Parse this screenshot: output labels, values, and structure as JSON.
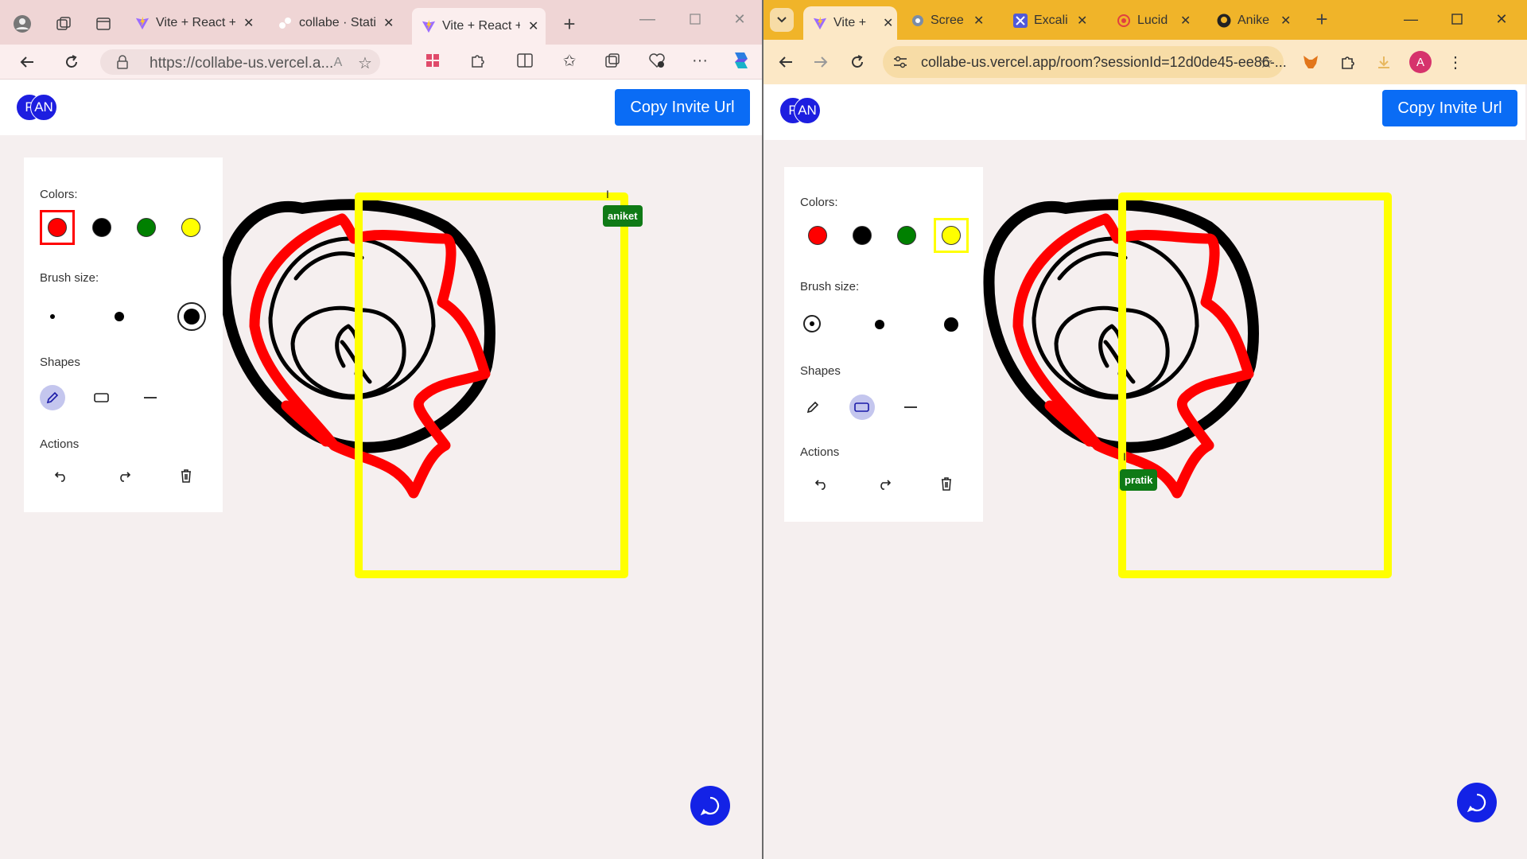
{
  "left_window": {
    "browser": "edge",
    "tabs": [
      {
        "title": "Vite + React +",
        "active": false
      },
      {
        "title": "collabe · Stati",
        "active": false
      },
      {
        "title": "Vite + React +",
        "active": true
      }
    ],
    "address": "https://collabe-us.vercel.a...",
    "app": {
      "avatars": [
        "P",
        "AN"
      ],
      "invite_label": "Copy Invite Url",
      "toolbox": {
        "colors_label": "Colors:",
        "brush_label": "Brush size:",
        "shapes_label": "Shapes",
        "actions_label": "Actions",
        "selected_color": "red",
        "selected_brush": "large",
        "selected_shape": "pencil"
      },
      "remote_cursor": {
        "name": "aniket"
      }
    }
  },
  "right_window": {
    "browser": "chrome",
    "tabs": [
      {
        "title": "Vite +",
        "active": true
      },
      {
        "title": "Scree",
        "active": false
      },
      {
        "title": "Excali",
        "active": false
      },
      {
        "title": "Lucid",
        "active": false
      },
      {
        "title": "Anike",
        "active": false
      }
    ],
    "address": "collabe-us.vercel.app/room?sessionId=12d0de45-ee86-...",
    "profile_initial": "A",
    "app": {
      "avatars": [
        "P",
        "AN"
      ],
      "invite_label": "Copy Invite Url",
      "toolbox": {
        "colors_label": "Colors:",
        "brush_label": "Brush size:",
        "shapes_label": "Shapes",
        "actions_label": "Actions",
        "selected_color": "yellow",
        "selected_brush": "small",
        "selected_shape": "rectangle"
      },
      "remote_cursor": {
        "name": "pratik"
      }
    }
  },
  "colors": {
    "red": "#ff0000",
    "black": "#000000",
    "green": "#008000",
    "yellow": "#ffff00",
    "accent": "#0a6cf5",
    "user_tag": "#0f7a16"
  }
}
